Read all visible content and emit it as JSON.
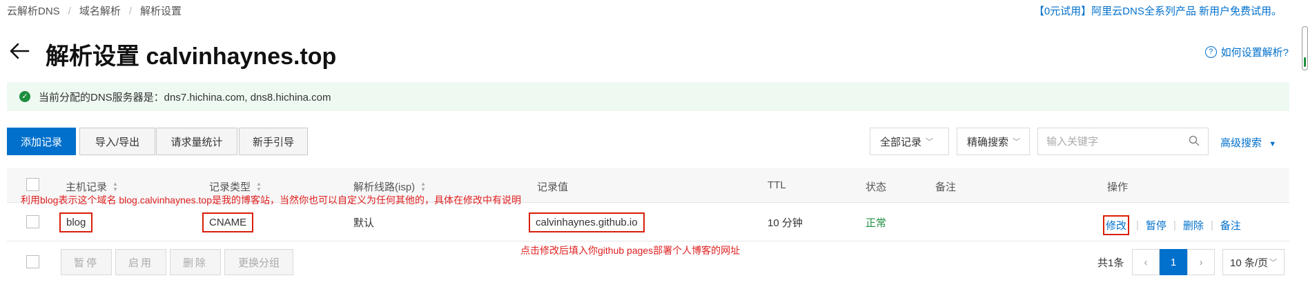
{
  "breadcrumb": [
    "云解析DNS",
    "域名解析",
    "解析设置"
  ],
  "breadcrumb_sep": "/",
  "promo": "【0元试用】阿里云DNS全系列产品 新用户免费试用。",
  "title": "解析设置 calvinhaynes.top",
  "help_link": "如何设置解析?",
  "info": {
    "text": "当前分配的DNS服务器是：dns7.hichina.com, dns8.hichina.com",
    "icon": "check-circle-icon"
  },
  "toolbar": {
    "add": "添加记录",
    "import_export": "导入/导出",
    "stats": "请求量统计",
    "guide": "新手引导",
    "record_filter": "全部记录",
    "search_mode": "精确搜索",
    "search_placeholder": "输入关键字",
    "advanced": "高级搜索"
  },
  "table": {
    "columns": [
      "主机记录",
      "记录类型",
      "解析线路(isp)",
      "记录值",
      "TTL",
      "状态",
      "备注",
      "操作"
    ],
    "rows": [
      {
        "host": "blog",
        "type": "CNAME",
        "line": "默认",
        "value": "calvinhaynes.github.io",
        "ttl": "10 分钟",
        "status": "正常",
        "remark": "",
        "actions": [
          "修改",
          "暂停",
          "删除",
          "备注"
        ]
      }
    ]
  },
  "annotations": {
    "row_note": "利用blog表示这个域名 blog.calvinhaynes.top是我的博客站，当然你也可以自定义为任何其他的，具体在修改中有说明",
    "value_note": "点击修改后填入你github pages部署个人博客的网址"
  },
  "bulk_actions": [
    "暂停",
    "启用",
    "删除",
    "更换分组"
  ],
  "pagination": {
    "total": "共1条",
    "current": "1",
    "page_size": "10 条/页"
  },
  "colors": {
    "primary": "#0070cc",
    "success": "#1e8e3e",
    "annotation": "#e02020",
    "info_bg": "#eef9f1"
  }
}
